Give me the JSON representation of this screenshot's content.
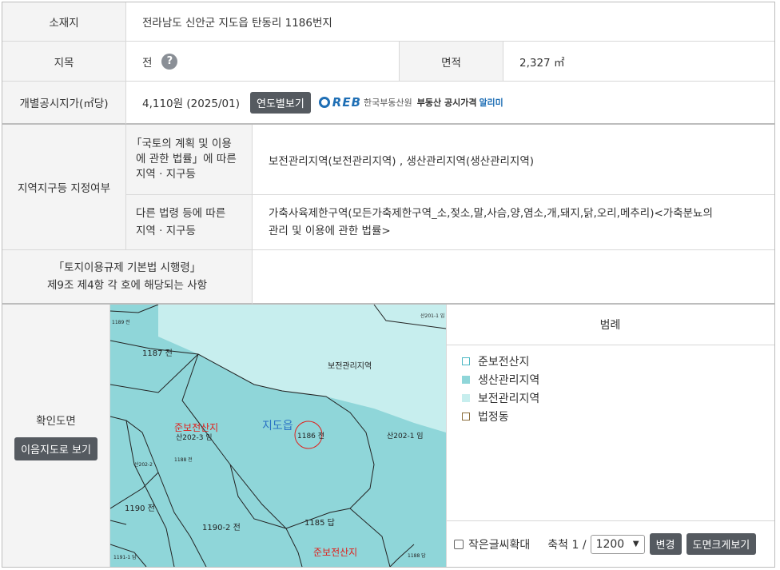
{
  "location": {
    "label": "소재지",
    "value": "전라남도 신안군 지도읍 탄동리 1186번지"
  },
  "land_category": {
    "label": "지목",
    "value": "전",
    "help_icon": "?"
  },
  "area": {
    "label": "면적",
    "value": "2,327 ㎡"
  },
  "price": {
    "label": "개별공시지가(㎡당)",
    "value": "4,110원 (2025/01)",
    "year_button": "연도별보기",
    "reb_logo": "REB",
    "reb_name": "한국부동산원",
    "reb_service_a": "부동산 공시가격",
    "reb_service_b": "알리미"
  },
  "zoning": {
    "label": "지역지구등 지정여부",
    "law1_label_line1": "「국토의 계획 및 이용",
    "law1_label_line2": "에 관한 법률」에 따른",
    "law1_label_line3": "지역 · 지구등",
    "law1_value": "보전관리지역(보전관리지역) , 생산관리지역(생산관리지역)",
    "law2_label_line1": "다른 법령 등에 따른",
    "law2_label_line2": "지역 · 지구등",
    "law2_value_line1": "가축사육제한구역(모든가축제한구역_소,젖소,말,사슴,양,염소,개,돼지,닭,오리,메추리)<가축분뇨의",
    "law2_value_line2": "관리 및 이용에 관한 법률>"
  },
  "regulation": {
    "label_line1": "「토지이용규제 기본법 시행령」",
    "label_line2": "제9조 제4항 각 호에 해당되는 사항",
    "value": ""
  },
  "map_section": {
    "label": "확인도면",
    "view_button": "이음지도로 보기",
    "map_labels": {
      "p1187": "1187 전",
      "reserve_zone": "보전관리지역",
      "jido": "지도읍",
      "semi_forest_1": "준보전산지",
      "p202_3": "산202-3 임",
      "p1186": "1186 전",
      "p202_1": "산202-1 임",
      "p1190": "1190 전",
      "p1190_2": "1190-2 전",
      "p1185": "1185 답",
      "semi_forest_2": "준보전산지",
      "tiny_1": "1189 전",
      "tiny_2": "산201-1 임",
      "tiny_3": "1188 전",
      "tiny_4": "산202-2",
      "tiny_5": "1188 답",
      "tiny_6": "1191-1 답"
    }
  },
  "legend": {
    "title": "범례",
    "items": [
      {
        "label": "준보전산지",
        "color": "#4db8c4",
        "style": "outline"
      },
      {
        "label": "생산관리지역",
        "color": "#8fd6d9",
        "style": "fill"
      },
      {
        "label": "보전관리지역",
        "color": "#c7eeee",
        "style": "fill"
      },
      {
        "label": "법정동",
        "color": "#8a6d3b",
        "style": "outline"
      }
    ]
  },
  "controls": {
    "small_text_checkbox": "작은글씨확대",
    "small_text_checked": false,
    "scale_prefix": "축척 1 /",
    "scale_value": "1200",
    "change_button": "변경",
    "enlarge_button": "도면크게보기"
  },
  "colors": {
    "header_bg": "#f4f4f4",
    "button_dark": "#555a60",
    "production_zone": "#8fd6d9",
    "reserve_zone": "#c7eeee",
    "map_red": "#e0201c",
    "map_blue": "#2a73c4"
  }
}
